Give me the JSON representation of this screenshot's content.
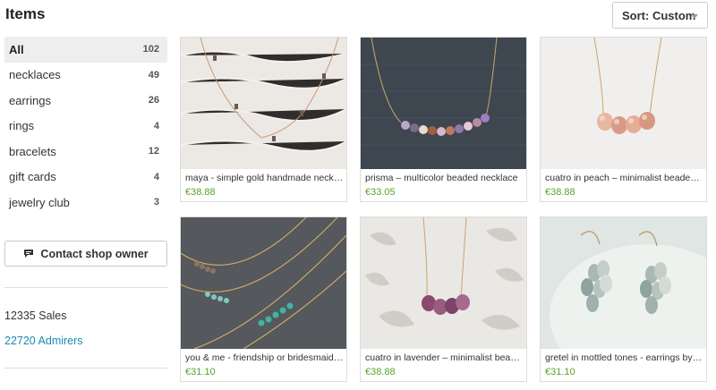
{
  "header": {
    "title": "Items"
  },
  "sort": {
    "label": "Sort: Custom"
  },
  "categories": [
    {
      "label": "All",
      "count": "102",
      "active": true
    },
    {
      "label": "necklaces",
      "count": "49"
    },
    {
      "label": "earrings",
      "count": "26"
    },
    {
      "label": "rings",
      "count": "4"
    },
    {
      "label": "bracelets",
      "count": "12"
    },
    {
      "label": "gift cards",
      "count": "4"
    },
    {
      "label": "jewelry club",
      "count": "3"
    }
  ],
  "contact": {
    "label": "Contact shop owner"
  },
  "shop_stats": {
    "sales": "12335 Sales",
    "admirers": "22720 Admirers"
  },
  "items": [
    {
      "name": "maya - simple gold handmade necklace",
      "price": "€38.88"
    },
    {
      "name": "prisma – multicolor beaded necklace",
      "price": "€33.05"
    },
    {
      "name": "cuatro in peach – minimalist beaded necklace",
      "price": "€38.88"
    },
    {
      "name": "you & me - friendship or bridesmaid necklace",
      "price": "€31.10"
    },
    {
      "name": "cuatro in lavender – minimalist beaded necklace",
      "price": "€38.88"
    },
    {
      "name": "gretel in mottled tones - earrings by etsy",
      "price": "€31.10"
    }
  ],
  "colors": {
    "price": "#59a22a",
    "link": "#1a8bb3",
    "active_bg": "#eeeeee"
  }
}
